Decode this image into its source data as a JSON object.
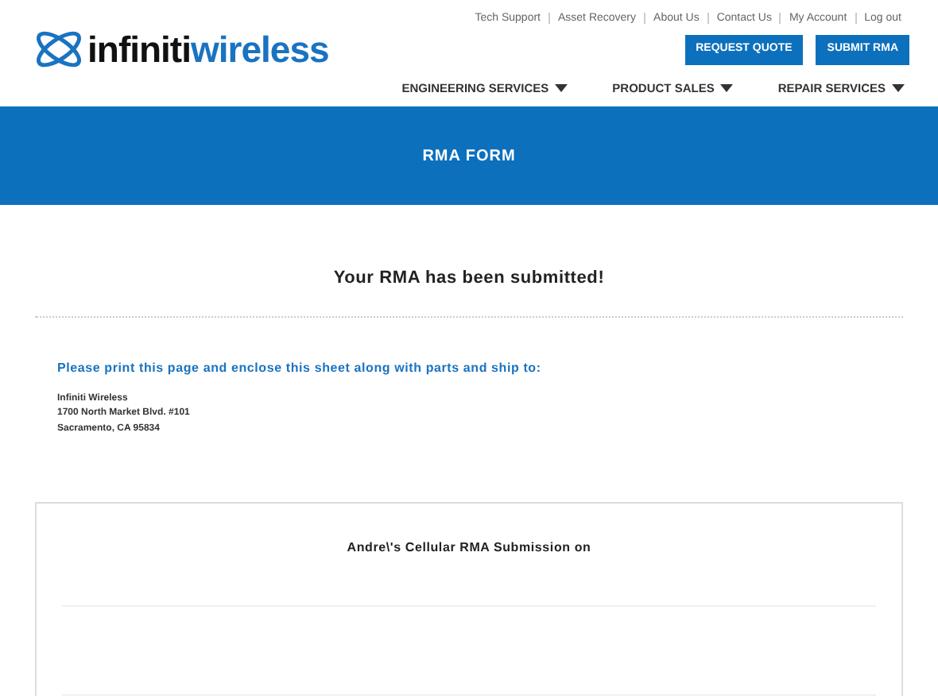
{
  "logo": {
    "part_1": "infiniti",
    "part_2": "wireless"
  },
  "top_links": [
    "Tech Support",
    "Asset Recovery",
    "About Us",
    "Contact Us",
    "My Account",
    "Log out"
  ],
  "buttons": [
    "REQUEST QUOTE",
    "SUBMIT RMA"
  ],
  "nav": [
    "ENGINEERING SERVICES",
    "PRODUCT SALES",
    "REPAIR SERVICES"
  ],
  "banner": {
    "title": "RMA FORM"
  },
  "heading": "Your RMA has been submitted!",
  "instructions": "Please print this page and enclose this sheet along with parts and ship to:",
  "address": [
    "Infiniti Wireless",
    "1700 North Market Blvd. #101",
    "Sacramento, CA 95834"
  ],
  "card": {
    "title": "Andre\\'s Cellular RMA Submission on"
  }
}
